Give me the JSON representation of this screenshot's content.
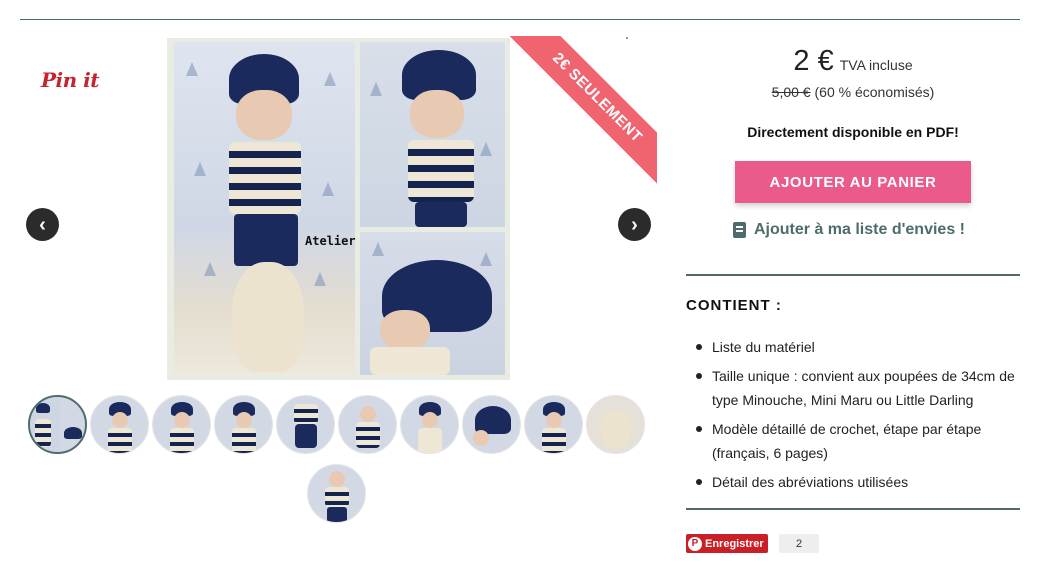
{
  "pin_it": {
    "label": "Pin it"
  },
  "gallery": {
    "watermark": "Atelier Crochet",
    "ribbon": "2€ SEULEMENT",
    "prev_arrow": "‹",
    "next_arrow": "›",
    "thumbnail_count": 11
  },
  "price": {
    "current": "2 €",
    "tax_note": "TVA incluse",
    "old": "5,00 €",
    "savings": "(60 % économisés)"
  },
  "availability": "Directement disponible en PDF!",
  "cart_button": "AJOUTER AU PANIER",
  "wishlist": {
    "label": "Ajouter à ma liste d'envies !",
    "icon": "bookmark-icon"
  },
  "contents": {
    "title": "CONTIENT :",
    "items": [
      "Liste du matériel",
      "Taille unique : convient aux poupées de 34cm de type Minouche, Mini Maru ou Little Darling",
      "Modèle détaillé de crochet, étape par étape (français, 6 pages)",
      "Détail des abréviations utilisées"
    ]
  },
  "pinterest": {
    "save_label": "Enregistrer",
    "count": "2"
  },
  "colors": {
    "accent": "#4f6c6c",
    "cart": "#ea5a8a",
    "ribbon": "#f06470",
    "pinterest": "#cb1f27"
  }
}
